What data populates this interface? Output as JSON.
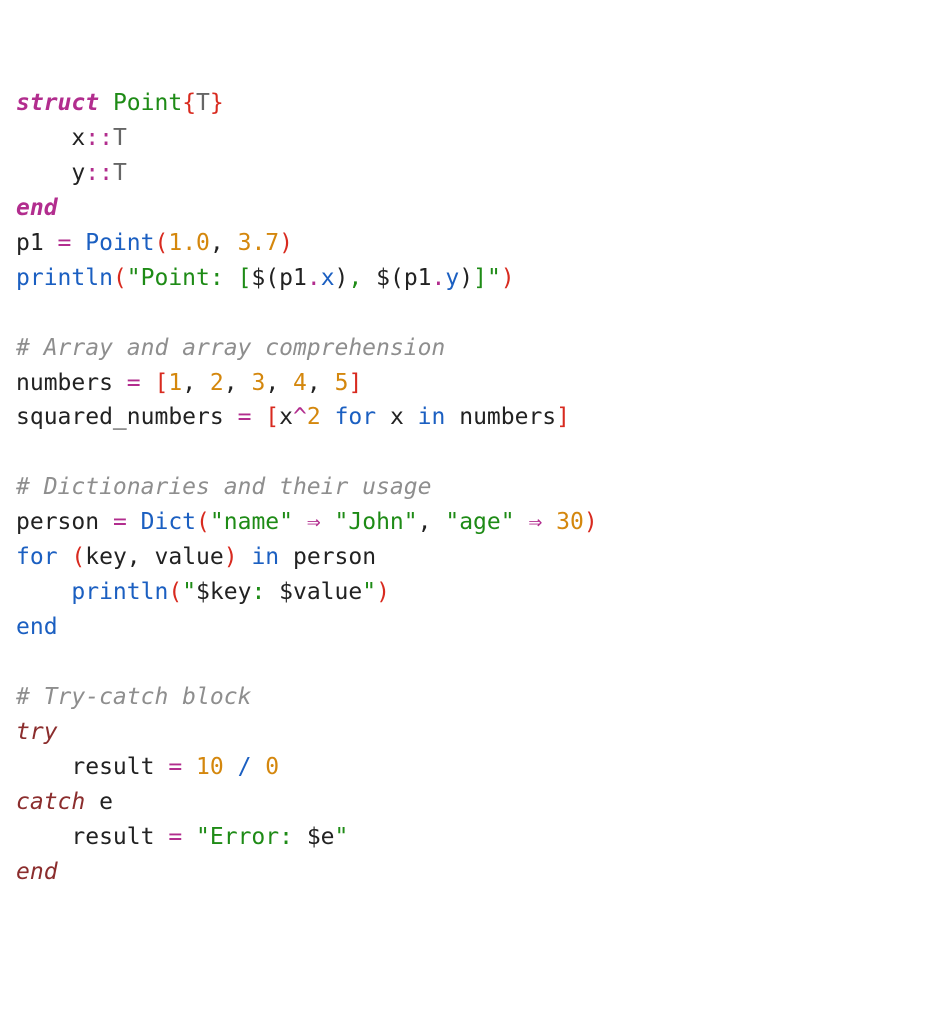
{
  "lines": {
    "l1_struct": "struct",
    "l1_point": " Point",
    "l1_lb": "{",
    "l1_t": "T",
    "l1_rb": "}",
    "l2_indent": "    x",
    "l2_colon": "::",
    "l2_t": "T",
    "l3_indent": "    y",
    "l3_colon": "::",
    "l3_t": "T",
    "l4_end": "end",
    "l5_p1": "p1 ",
    "l5_eq": "=",
    "l5_point": " Point",
    "l5_lp": "(",
    "l5_n1": "1.0",
    "l5_c1": ", ",
    "l5_n2": "3.7",
    "l5_rp": ")",
    "l6_fn": "println",
    "l6_lp": "(",
    "l6_s1": "\"Point: [",
    "l6_d1": "$(",
    "l6_p1": "p1",
    "l6_dot1": ".",
    "l6_x": "x",
    "l6_d1e": ")",
    "l6_s2": ", ",
    "l6_d2": "$(",
    "l6_p2": "p1",
    "l6_dot2": ".",
    "l6_y": "y",
    "l6_d2e": ")",
    "l6_s3": "]\"",
    "l6_rp": ")",
    "l8_comment": "# Array and array comprehension",
    "l9_name": "numbers ",
    "l9_eq": "=",
    "l9_sp": " ",
    "l9_lb": "[",
    "l9_n1": "1",
    "l9_c1": ", ",
    "l9_n2": "2",
    "l9_c2": ", ",
    "l9_n3": "3",
    "l9_c3": ", ",
    "l9_n4": "4",
    "l9_c4": ", ",
    "l9_n5": "5",
    "l9_rb": "]",
    "l10_name": "squared_numbers ",
    "l10_eq": "=",
    "l10_sp": " ",
    "l10_lb": "[",
    "l10_x": "x",
    "l10_caret": "^",
    "l10_2": "2",
    "l10_for": " for ",
    "l10_x2": "x ",
    "l10_in": "in",
    "l10_num": " numbers",
    "l10_rb": "]",
    "l12_comment": "# Dictionaries and their usage",
    "l13_name": "person ",
    "l13_eq": "=",
    "l13_dict": " Dict",
    "l13_lp": "(",
    "l13_s1": "\"name\"",
    "l13_ar1": " ⇒ ",
    "l13_s2": "\"John\"",
    "l13_c1": ", ",
    "l13_s3": "\"age\"",
    "l13_ar2": " ⇒ ",
    "l13_n": "30",
    "l13_rp": ")",
    "l14_for": "for",
    "l14_sp": " ",
    "l14_lp": "(",
    "l14_k": "key, value",
    "l14_rp": ")",
    "l14_in": " in ",
    "l14_p": "person",
    "l15_indent": "    ",
    "l15_fn": "println",
    "l15_lp": "(",
    "l15_s1": "\"",
    "l15_d1": "$key",
    "l15_s2": ": ",
    "l15_d2": "$value",
    "l15_s3": "\"",
    "l15_rp": ")",
    "l16_end": "end",
    "l18_comment": "# Try-catch block",
    "l19_try": "try",
    "l20_indent": "    result ",
    "l20_eq": "=",
    "l20_sp": " ",
    "l20_10": "10",
    "l20_div": " / ",
    "l20_0": "0",
    "l21_catch": "catch",
    "l21_e": " e",
    "l22_indent": "    result ",
    "l22_eq": "=",
    "l22_sp": " ",
    "l22_s1": "\"Error: ",
    "l22_d": "$e",
    "l22_s2": "\"",
    "l23_end": "end"
  }
}
